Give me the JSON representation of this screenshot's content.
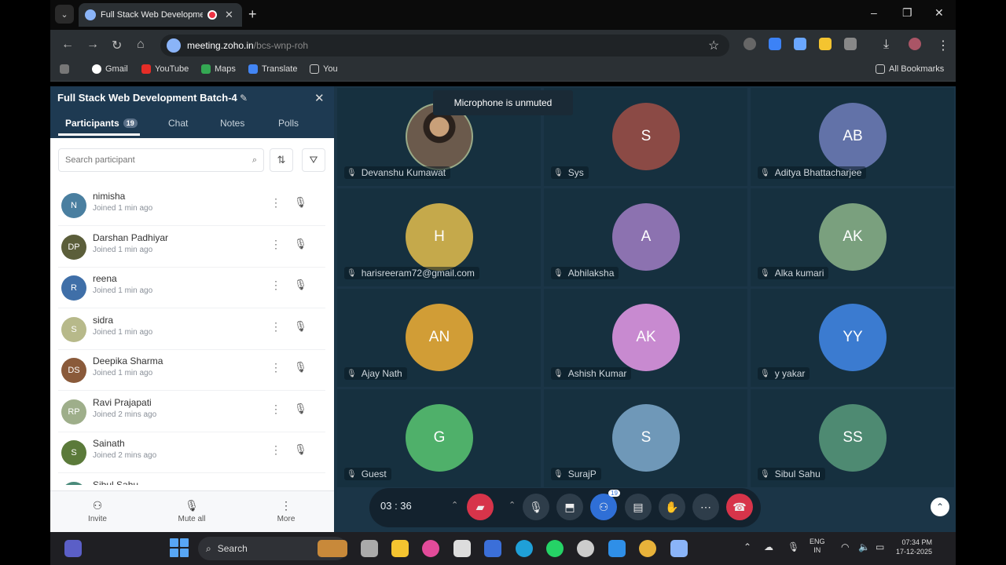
{
  "browser": {
    "tab_title": "Full Stack Web Development",
    "url_domain": "meeting.zoho.in",
    "url_path": "/bcs-wnp-roh",
    "bookmarks": [
      "Gmail",
      "YouTube",
      "Maps",
      "Translate",
      "You"
    ],
    "all_bookmarks": "All Bookmarks"
  },
  "sidebar": {
    "title": "Full Stack Web Development Batch-4",
    "tabs": {
      "participants": "Participants",
      "count": "19",
      "chat": "Chat",
      "notes": "Notes",
      "polls": "Polls"
    },
    "search_placeholder": "Search participant",
    "participants": [
      {
        "initials": "N",
        "name": "nimisha",
        "joined": "Joined 1 min ago",
        "color": "#4a7fa0"
      },
      {
        "initials": "DP",
        "name": "Darshan Padhiyar",
        "joined": "Joined 1 min ago",
        "color": "#5b5e3a"
      },
      {
        "initials": "R",
        "name": "reena",
        "joined": "Joined 1 min ago",
        "color": "#3f6fa8"
      },
      {
        "initials": "S",
        "name": "sidra",
        "joined": "Joined 1 min ago",
        "color": "#b7b98a"
      },
      {
        "initials": "DS",
        "name": "Deepika Sharma",
        "joined": "Joined 1 min ago",
        "color": "#8a5a3a"
      },
      {
        "initials": "RP",
        "name": "Ravi Prajapati",
        "joined": "Joined 2 mins ago",
        "color": "#9eae8a"
      },
      {
        "initials": "S",
        "name": "Sainath",
        "joined": "Joined 2 mins ago",
        "color": "#5b7a3a"
      },
      {
        "initials": "SS",
        "name": "Sibul Sahu",
        "joined": "",
        "color": "#4a8a7a"
      }
    ],
    "footer": {
      "invite": "Invite",
      "mute_all": "Mute all",
      "more": "More"
    }
  },
  "toast": "Microphone is unmuted",
  "tiles": [
    {
      "initials": "",
      "name": "Devanshu Kumawat",
      "color": "#7a5a40",
      "photo": true
    },
    {
      "initials": "S",
      "name": "Sys",
      "color": "#8b4a45"
    },
    {
      "initials": "AB",
      "name": "Aditya Bhattacharjee",
      "color": "#6272a8"
    },
    {
      "initials": "H",
      "name": "harisreeram72@gmail.com",
      "color": "#c5a94b"
    },
    {
      "initials": "A",
      "name": "Abhilaksha",
      "color": "#8c72b0"
    },
    {
      "initials": "AK",
      "name": "Alka kumari",
      "color": "#7aa07e"
    },
    {
      "initials": "AN",
      "name": "Ajay Nath",
      "color": "#d19d36"
    },
    {
      "initials": "AK",
      "name": "Ashish Kumar",
      "color": "#c88ad0"
    },
    {
      "initials": "YY",
      "name": "y yakar",
      "color": "#3b7bd0"
    },
    {
      "initials": "G",
      "name": "Guest",
      "color": "#4fb06a"
    },
    {
      "initials": "S",
      "name": "SurajP",
      "color": "#6f98b8"
    },
    {
      "initials": "SS",
      "name": "Sibul Sahu",
      "color": "#4e8a72"
    }
  ],
  "controls": {
    "timer": "03 : 36",
    "people_count": "19"
  },
  "taskbar": {
    "search": "Search",
    "lang_top": "ENG",
    "lang_bottom": "IN",
    "time": "07:34 PM",
    "date": "17-12-2025"
  }
}
